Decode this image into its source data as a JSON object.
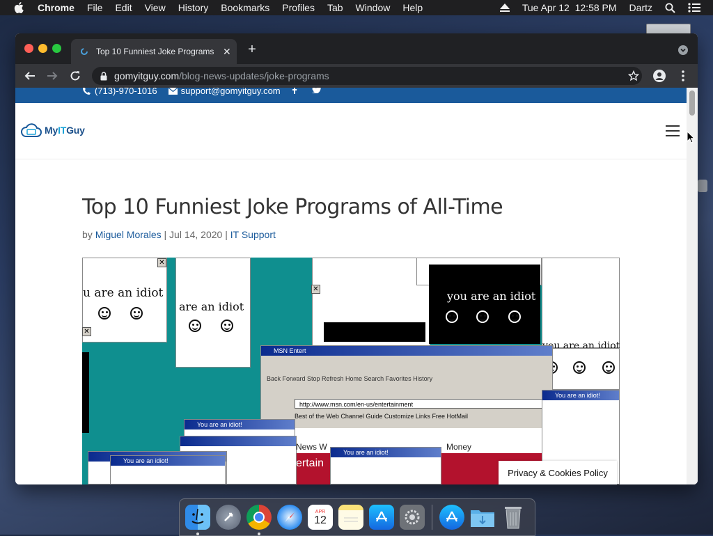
{
  "menubar": {
    "app_name": "Chrome",
    "items": [
      "File",
      "Edit",
      "View",
      "History",
      "Bookmarks",
      "Profiles",
      "Tab",
      "Window",
      "Help"
    ],
    "datetime": "Tue Apr 12  12:58 PM",
    "user": "Dartz"
  },
  "browser": {
    "tab_title": "Top 10 Funniest Joke Programs",
    "url_host": "gomyitguy.com",
    "url_path": "/blog-news-updates/joke-programs"
  },
  "site": {
    "phone": "(713)-970-1016",
    "email": "support@gomyitguy.com",
    "logo_my": "My",
    "logo_it": "IT",
    "logo_guy": "Guy"
  },
  "post": {
    "title": "Top 10 Funniest Joke Programs of All-Time",
    "meta_by": "by ",
    "author": "Miguel Morales",
    "sep1": " | ",
    "date": "Jul 14, 2020",
    "sep2": " | ",
    "category": "IT Support"
  },
  "hero_image": {
    "caption_texts": {
      "idiot_1": "u are an idiot",
      "idiot_2": "are an idiot",
      "idiot_3": "you are an idiot",
      "idiot_4": "you are an idiot",
      "popup_title": "You are an idiot!",
      "ie_title": "MSN Entert",
      "ie_address": "http://www.msn.com/en-us/entertainment",
      "ie_links": "Best of the Web   Channel Guide   Customize Links   Free HotMail",
      "ie_buttons": "Back   Forward   Stop   Refresh   Home   Search   Favorites   History",
      "news": "News W",
      "money": "Money",
      "ertain": "ertain"
    }
  },
  "privacy_label": "Privacy & Cookies Policy",
  "dock": {
    "calendar_month": "APR",
    "calendar_day": "12"
  },
  "colors": {
    "site_blue": "#1a5a9b",
    "chrome_dark": "#202124",
    "teal": "#0f8f8f"
  }
}
